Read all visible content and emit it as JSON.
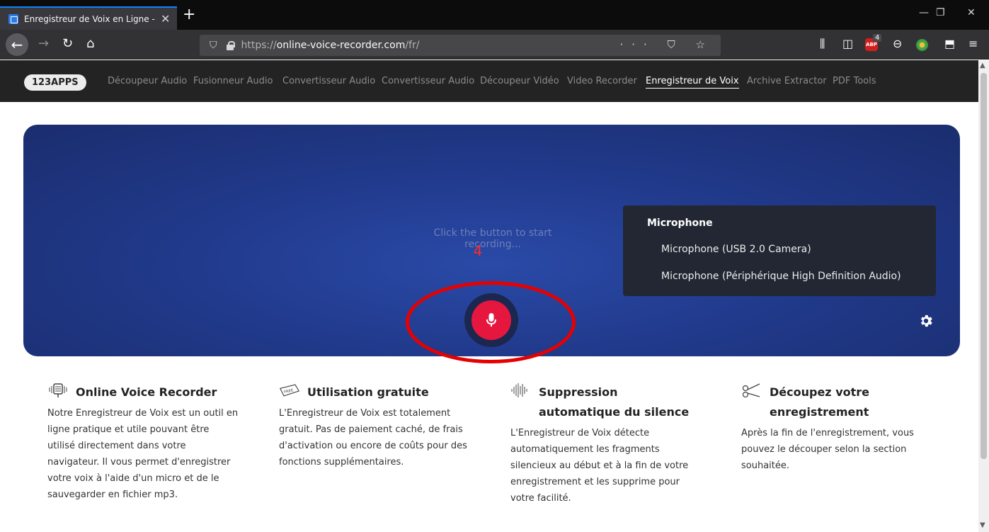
{
  "browser": {
    "tab_title": "Enregistreur de Voix en Ligne -",
    "tab_close": "✕",
    "new_tab": "+",
    "url_scheme": "https://",
    "url_host": "online-voice-recorder.com",
    "url_path": "/fr/",
    "url_actions": "··· ⛉ ☆",
    "adblock_label": "ABP",
    "adblock_count": "4",
    "window_minimize": "—",
    "window_restore": "❐",
    "window_close": "✕"
  },
  "site": {
    "logo": "123APPS",
    "nav": [
      "Découpeur Audio",
      "Fusionneur Audio",
      "Convertisseur Audio",
      "Convertisseur Audio",
      "Découpeur Vidéo",
      "Video Recorder",
      "Enregistreur de Voix",
      "Archive Extractor",
      "PDF Tools"
    ],
    "active_nav": "Enregistreur de Voix"
  },
  "recorder": {
    "hint": "Click the button to start recording...",
    "countdown": "4",
    "mic_menu": {
      "title": "Microphone",
      "items": [
        "Microphone (USB 2.0 Camera)",
        "Microphone (Périphérique High Definition Audio)"
      ]
    }
  },
  "features": [
    {
      "title": "Online Voice Recorder",
      "icon": "microphone-icon",
      "text": "Notre Enregistreur de Voix est un outil en ligne pratique et utile pouvant être utilisé directement dans votre navigateur. Il vous permet d'enregistrer votre voix à l'aide d'un micro et de le sauvegarder en fichier mp3."
    },
    {
      "title": "Utilisation gratuite",
      "icon": "free-tag-icon",
      "text": "L'Enregistreur de Voix est totalement gratuit. Pas de paiement caché, de frais d'activation ou encore de coûts pour des fonctions supplémentaires."
    },
    {
      "title": "Suppression automatique du silence",
      "icon": "waveform-icon",
      "text": "L'Enregistreur de Voix détecte automatiquement les fragments silencieux au début et à la fin de votre enregistrement et les supprime pour votre facilité."
    },
    {
      "title": "Découpez votre enregistrement",
      "icon": "scissors-icon",
      "text": "Après la fin de l'enregistrement, vous pouvez le découper selon la section souhaitée."
    }
  ],
  "colors": {
    "record_button": "#e5173f",
    "annotation_ring": "#e60000",
    "countdown": "#ff2b2b"
  }
}
